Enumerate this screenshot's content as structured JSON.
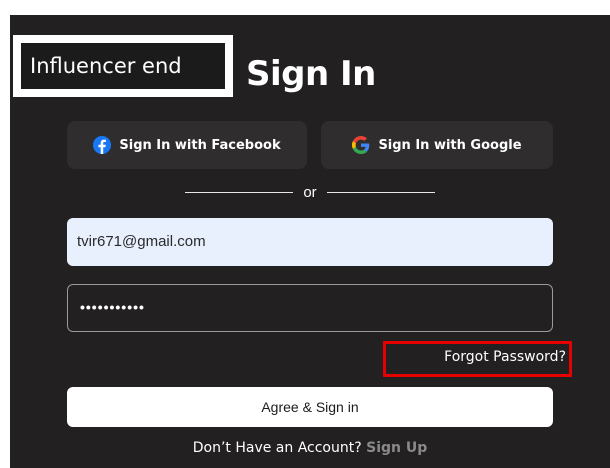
{
  "annotation": {
    "label": "Influencer end"
  },
  "page": {
    "title": "Sign In"
  },
  "social": {
    "facebook_label": "Sign In with Facebook",
    "google_label": "Sign In with Google",
    "facebook_icon": "facebook-icon",
    "google_icon": "google-icon"
  },
  "divider": {
    "text": "or"
  },
  "form": {
    "email_value": "tvir671@gmail.com",
    "password_masked": "•••••••••••",
    "forgot_label": "Forgot Password?",
    "submit_label": "Agree & Sign in"
  },
  "footer": {
    "prompt": "Don’t Have an Account?",
    "signup_label": "Sign Up"
  },
  "colors": {
    "background": "#222020",
    "button_dark": "#2f2d2d",
    "email_fill": "#e8f0fe",
    "highlight_red": "#e60000",
    "facebook_blue": "#1877f2"
  }
}
